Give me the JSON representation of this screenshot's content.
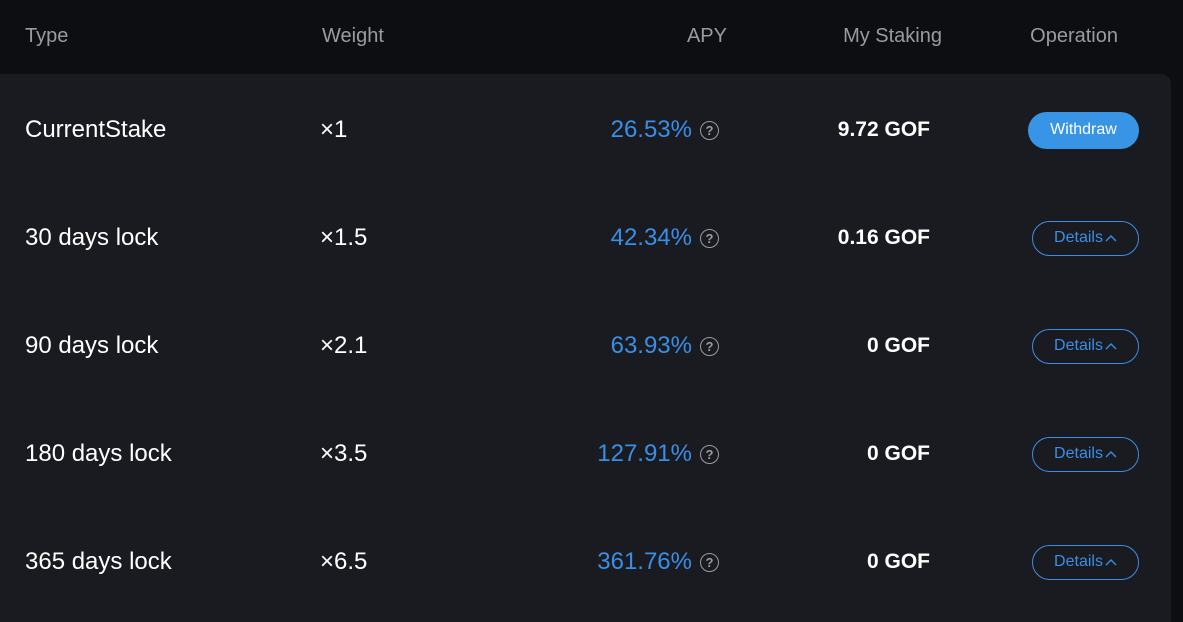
{
  "header": {
    "type": "Type",
    "weight": "Weight",
    "apy": "APY",
    "my_staking": "My Staking",
    "operation": "Operation"
  },
  "rows": [
    {
      "type": "CurrentStake",
      "weight": "×1",
      "apy": "26.53%",
      "staking": "9.72 GOF",
      "action": "Withdraw",
      "action_kind": "primary"
    },
    {
      "type": "30 days lock",
      "weight": "×1.5",
      "apy": "42.34%",
      "staking": "0.16 GOF",
      "action": "Details",
      "action_kind": "outline"
    },
    {
      "type": "90 days lock",
      "weight": "×2.1",
      "apy": "63.93%",
      "staking": "0 GOF",
      "action": "Details",
      "action_kind": "outline"
    },
    {
      "type": "180 days lock",
      "weight": "×3.5",
      "apy": "127.91%",
      "staking": "0 GOF",
      "action": "Details",
      "action_kind": "outline"
    },
    {
      "type": "365 days lock",
      "weight": "×6.5",
      "apy": "361.76%",
      "staking": "0 GOF",
      "action": "Details",
      "action_kind": "outline"
    }
  ],
  "icons": {
    "help": "question-circle-icon",
    "chevron": "chevron-up-icon"
  },
  "colors": {
    "background": "#0d0e12",
    "panel": "#1a1b20",
    "accent": "#3a8ee6",
    "header_text": "#9a9ba1",
    "text": "#ffffff"
  }
}
